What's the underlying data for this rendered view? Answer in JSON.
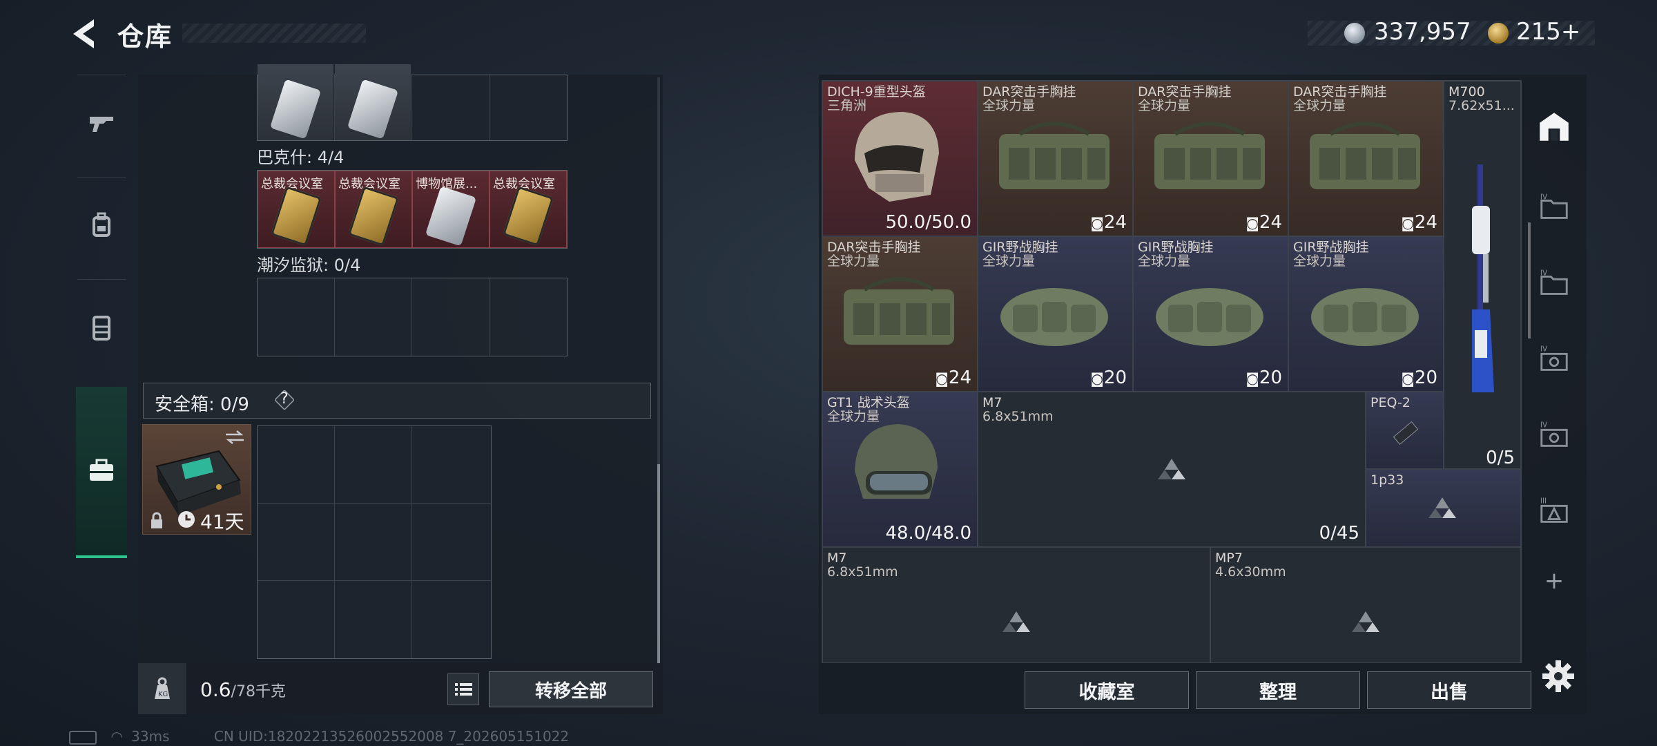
{
  "header": {
    "title": "仓库",
    "silver": "337,957",
    "gold": "215",
    "gold_plus": "+"
  },
  "left": {
    "row_a_label": "巴克什: 4/4",
    "row_a_cards": [
      "总裁会议室",
      "总裁会议室",
      "博物馆展...",
      "总裁会议室"
    ],
    "row_b_label": "潮汐监狱: 0/4",
    "safe_label": "安全箱: 0/9",
    "safe_help": "?",
    "safe_days": "41天",
    "weight": "0.6",
    "weight_max": "/78千克",
    "transfer_all": "转移全部"
  },
  "inventory": {
    "r1": [
      {
        "name": "DICH-9重型头盔",
        "sub": "三角洲",
        "num": "50.0/50.0"
      },
      {
        "name": "DAR突击手胸挂",
        "sub": "全球力量",
        "num": "24"
      },
      {
        "name": "DAR突击手胸挂",
        "sub": "全球力量",
        "num": "24"
      },
      {
        "name": "DAR突击手胸挂",
        "sub": "全球力量",
        "num": "24"
      }
    ],
    "m700_name": "M700",
    "m700_sub": "7.62x51...",
    "r2": [
      {
        "name": "DAR突击手胸挂",
        "sub": "全球力量",
        "num": "24"
      },
      {
        "name": "GIR野战胸挂",
        "sub": "全球力量",
        "num": "20"
      },
      {
        "name": "GIR野战胸挂",
        "sub": "全球力量",
        "num": "20"
      },
      {
        "name": "GIR野战胸挂",
        "sub": "全球力量",
        "num": "20"
      }
    ],
    "gt1_name": "GT1 战术头盔",
    "gt1_sub": "全球力量",
    "gt1_num": "48.0/48.0",
    "m7a_name": "M7",
    "m7a_sub": "6.8x51mm",
    "m7a_num": "0/45",
    "peq_name": "PEQ-2",
    "m700_num": "0/5",
    "p33_name": "1p33",
    "m7b_name": "M7",
    "m7b_sub": "6.8x51mm",
    "mp7_name": "MP7",
    "mp7_sub": "4.6x30mm",
    "rail_plus": "+"
  },
  "footer": {
    "collection": "收藏室",
    "organize": "整理",
    "sell": "出售"
  },
  "status": {
    "ping": "33ms",
    "uid": "CN UID:18202213526002552008 7_202605151022"
  }
}
